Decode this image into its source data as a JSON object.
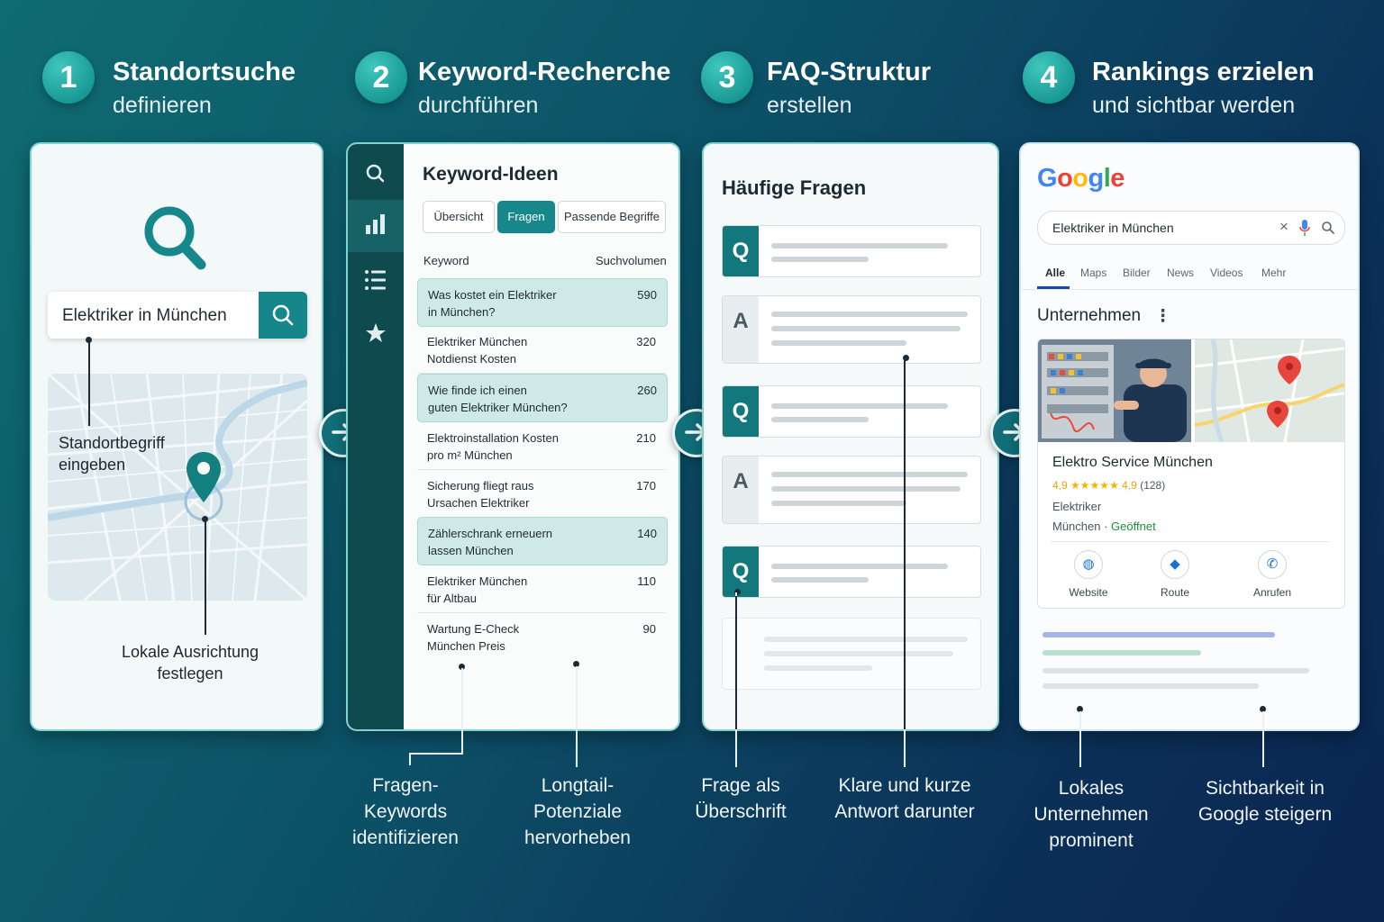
{
  "steps": [
    {
      "num": "1",
      "title": "Standortsuche",
      "sub": "definieren"
    },
    {
      "num": "2",
      "title": "Keyword-Recherche",
      "sub": "durchführen"
    },
    {
      "num": "3",
      "title": "FAQ-Struktur",
      "sub": "erstellen"
    },
    {
      "num": "4",
      "title": "Rankings erzielen",
      "sub": "und sichtbar werden"
    }
  ],
  "card1": {
    "search_value": "Elektriker in München",
    "label_top": [
      "Standortbegriff",
      "eingeben"
    ],
    "label_bottom": [
      "Lokale Ausrichtung",
      "festlegen"
    ]
  },
  "card2": {
    "title": "Keyword-Ideen",
    "tabs": [
      "Übersicht",
      "Fragen",
      "Passende Begriffe"
    ],
    "col_keyword": "Keyword",
    "col_volume": "Suchvolumen",
    "rows": [
      {
        "k1": "Was kostet ein Elektriker",
        "k2": "in München?",
        "v": "590"
      },
      {
        "k1": "Elektriker München",
        "k2": "Notdienst Kosten",
        "v": "320"
      },
      {
        "k1": "Wie finde ich einen",
        "k2": "guten Elektriker München?",
        "v": "260"
      },
      {
        "k1": "Elektroinstallation Kosten",
        "k2": "pro m² München",
        "v": "210"
      },
      {
        "k1": "Sicherung fliegt raus",
        "k2": "Ursachen Elektriker",
        "v": "170"
      },
      {
        "k1": "Zählerschrank erneuern",
        "k2": "lassen München",
        "v": "140"
      },
      {
        "k1": "Elektriker München",
        "k2": "für Altbau",
        "v": "110"
      },
      {
        "k1": "Wartung E-Check",
        "k2": "München Preis",
        "v": "90"
      }
    ]
  },
  "card3": {
    "title": "Häufige Fragen",
    "q": "Q",
    "a": "A"
  },
  "card4": {
    "logo": "Google",
    "search_value": "Elektriker in München",
    "tabs": [
      "Alle",
      "Maps",
      "Bilder",
      "News",
      "Videos",
      "Mehr"
    ],
    "section": "Unternehmen",
    "biz_name": "Elektro Service München",
    "rating": "4,9",
    "stars": "★★★★★",
    "rating2": "4,9",
    "reviews": "(128)",
    "category": "Elektriker",
    "city": "München",
    "status": "Geöffnet",
    "actions": [
      "Website",
      "Route",
      "Anrufen"
    ]
  },
  "captions": {
    "c2a": [
      "Fragen-Keywords",
      "identifizieren"
    ],
    "c2b": [
      "Longtail-Potenziale",
      "hervorheben"
    ],
    "c3a": [
      "Frage als",
      "Überschrift"
    ],
    "c3b": [
      "Klare und kurze",
      "Antwort darunter"
    ],
    "c4a": [
      "Lokales Unternehmen",
      "prominent"
    ],
    "c4b": [
      "Sichtbarkeit in",
      "Google steigern"
    ]
  },
  "colors": {
    "accent": "#16878a",
    "sidebar": "#0f4b4e",
    "pin": "#13807f"
  }
}
